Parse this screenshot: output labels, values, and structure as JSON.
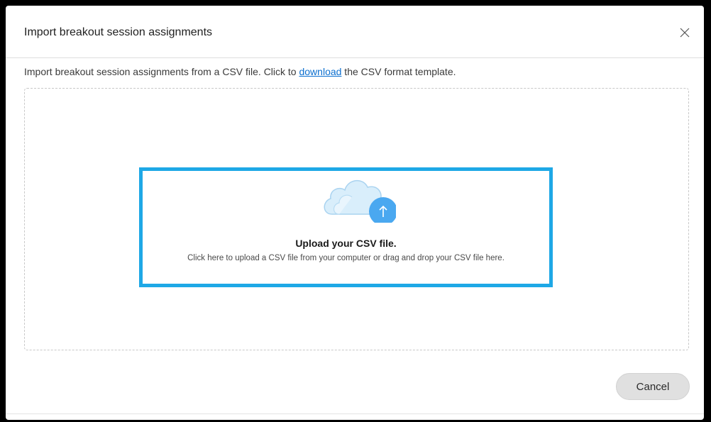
{
  "dialog": {
    "title": "Import breakout session assignments",
    "close_icon": "close-icon"
  },
  "description": {
    "prefix": "Import breakout session assignments from a CSV file. Click to ",
    "link_text": "download",
    "suffix": " the CSV format template."
  },
  "dropzone": {
    "icon": "cloud-upload-icon",
    "title": "Upload your CSV file.",
    "subtitle": "Click here to upload a CSV file from your computer or drag and drop your CSV file here."
  },
  "footer": {
    "cancel_label": "Cancel"
  },
  "colors": {
    "highlight_border": "#1ea8e6",
    "link": "#0a6ecf",
    "upload_circle": "#4aa8f0",
    "cloud_fill": "#d9eefb"
  }
}
